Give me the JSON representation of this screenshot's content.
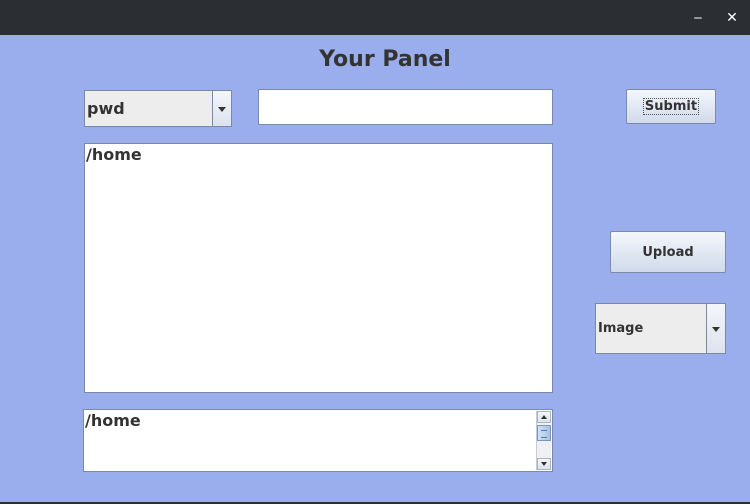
{
  "window": {
    "minimize_glyph": "‒",
    "close_glyph": "✕"
  },
  "panel": {
    "title": "Your Panel"
  },
  "command_combo": {
    "selected": "pwd"
  },
  "command_input": {
    "value": ""
  },
  "submit_button": {
    "label": "Submit"
  },
  "output_area": {
    "text": "/home"
  },
  "upload_button": {
    "label": "Upload"
  },
  "type_combo": {
    "selected": "Image"
  },
  "path_area": {
    "text": "/home"
  },
  "colors": {
    "panel_bg": "#9aadec",
    "titlebar_bg": "#2b2e33"
  }
}
